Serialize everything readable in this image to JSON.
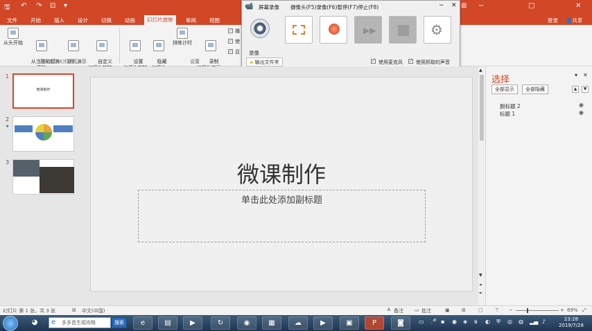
{
  "quick_access": {
    "save_icon": "save-icon",
    "undo_icon": "undo-icon",
    "redo_icon": "redo-icon",
    "customize_icon": "customize-icon"
  },
  "tabs": [
    "文件",
    "开始",
    "插入",
    "设计",
    "切换",
    "动画",
    "幻灯片放映",
    "审阅",
    "视图"
  ],
  "active_tab": "幻灯片放映",
  "right_tools": {
    "login": "登录",
    "share": "共享"
  },
  "ribbon": {
    "group1": {
      "label": "开始放映幻灯片",
      "buttons": [
        {
          "label": "从头开始"
        },
        {
          "label": "从当前幻灯片\n开始"
        },
        {
          "label": "联机演示\n▾"
        },
        {
          "label": "自定义\n幻灯片放映 ▾"
        }
      ]
    },
    "group2": {
      "label": "设置",
      "buttons": [
        {
          "label": "设置\n幻灯片放映"
        },
        {
          "label": "隐藏\n幻灯片"
        },
        {
          "label": "排练计时"
        },
        {
          "label": "录制\n幻灯片演示 ▾"
        }
      ],
      "checkbox_chars": [
        "播",
        "使",
        "显"
      ]
    }
  },
  "recorder": {
    "title": "屏幕录像",
    "hotkeys": "摄像头(F5)录像(F6)暂停(F7)停止(F8)",
    "record_label": "录像",
    "output_folder": "输出文件夹",
    "use_mic": "使用麦克风",
    "use_sound": "使用抓取的声音",
    "use_mic_checked": true,
    "use_sound_checked": true
  },
  "thumbnails": [
    {
      "num": "1",
      "text": "微课制作"
    },
    {
      "num": "2",
      "star": "★"
    },
    {
      "num": "3"
    }
  ],
  "slide": {
    "title": "微课制作",
    "subtitle_placeholder": "单击此处添加副标题"
  },
  "selection_pane": {
    "title": "选择",
    "show_all": "全部显示",
    "hide_all": "全部隐藏",
    "items": [
      "副标题 2",
      "标题 1"
    ]
  },
  "status": {
    "slide_info": "幻灯片 第 1 张，共 3 张",
    "language": "中文(中国)",
    "notes": "备注",
    "comments": "批注",
    "zoom": "69%"
  },
  "taskbar": {
    "search_placeholder": "多多首生福攻略",
    "search_button": "搜索",
    "time": "23:28",
    "date": "2019/7/28"
  },
  "colors": {
    "accent": "#d24726",
    "taskbar": "#2a4461"
  }
}
